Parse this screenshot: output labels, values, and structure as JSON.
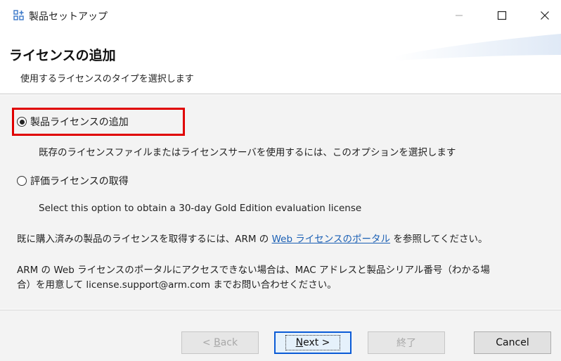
{
  "window": {
    "title": "製品セットアップ",
    "app_icon": "setup-grid-icon",
    "controls": {
      "minimize": "minimize-icon",
      "maximize": "maximize-icon",
      "close": "close-icon"
    }
  },
  "header": {
    "title": "ライセンスの追加",
    "subtitle": "使用するライセンスのタイプを選択します"
  },
  "options": [
    {
      "label": "製品ライセンスの追加",
      "selected": true,
      "description": "既存のライセンスファイルまたはライセンスサーバを使用するには、このオプションを選択します"
    },
    {
      "label": "評価ライセンスの取得",
      "selected": false,
      "description": "Select this option to obtain a 30-day Gold Edition evaluation license"
    }
  ],
  "info": {
    "purchased_prefix": "既に購入済みの製品のライセンスを取得するには、ARM の ",
    "purchased_link": "Web ライセンスのポータル",
    "purchased_suffix": " を参照してください。",
    "contact_line1": "ARM の Web ライセンスのポータルにアクセスできない場合は、MAC アドレスと製品シリアル番号（わかる場",
    "contact_line2": "合）を用意して license.support@arm.com までお問い合わせください。"
  },
  "buttons": {
    "back_prefix": "< ",
    "back_accel": "B",
    "back_rest": "ack",
    "next_accel": "N",
    "next_rest": "ext >",
    "finish": "終了",
    "cancel": "Cancel"
  },
  "colors": {
    "highlight": "#e00000",
    "link": "#1a5fb4",
    "default_button_border": "#0a5bd6"
  }
}
